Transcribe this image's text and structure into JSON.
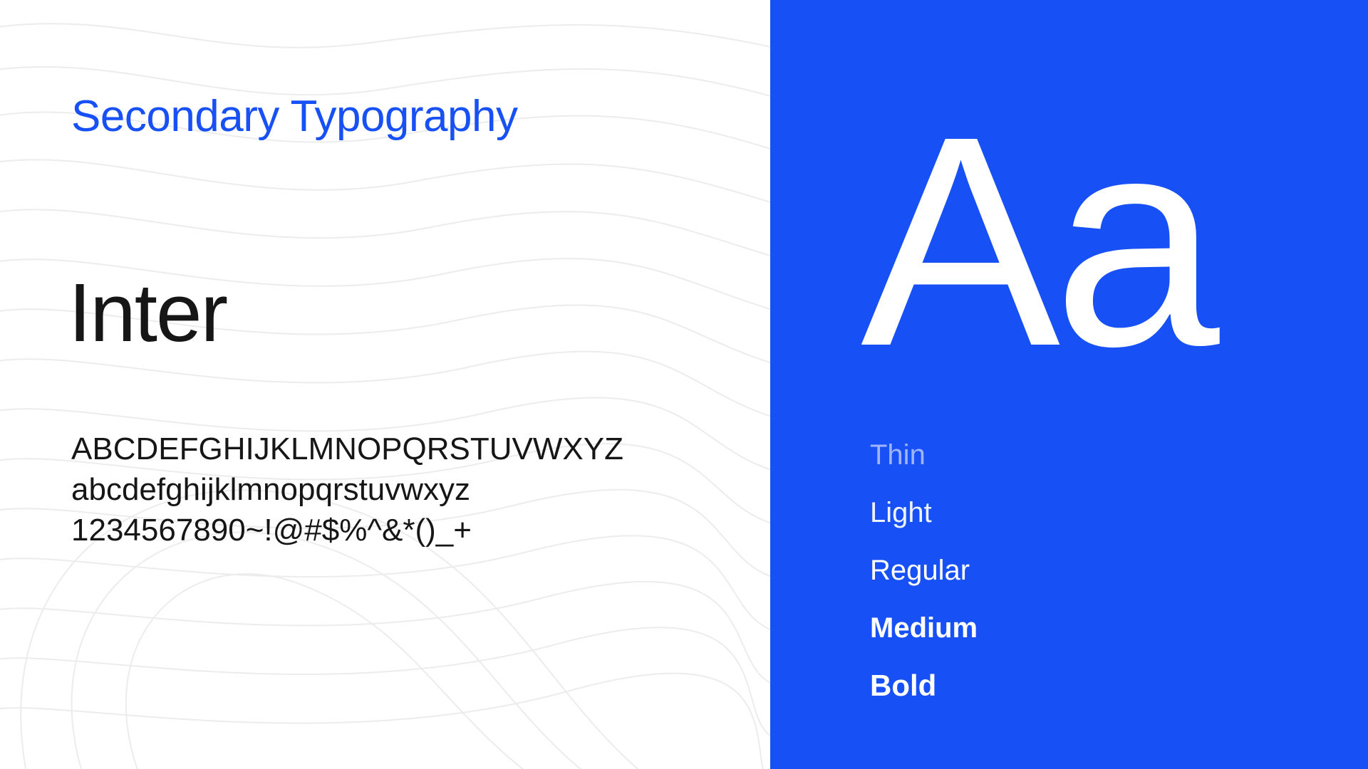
{
  "slide": {
    "title": "Secondary Typography",
    "font_name": "Inter",
    "charset": {
      "uppercase": "ABCDEFGHIJKLMNOPQRSTUVWXYZ",
      "lowercase": "abcdefghijklmnopqrstuvwxyz",
      "numbers_symbols": "1234567890~!@#$%^&*()_+"
    },
    "specimen": "Aa",
    "weights": [
      {
        "label": "Thin"
      },
      {
        "label": "Light"
      },
      {
        "label": "Regular"
      },
      {
        "label": "Medium"
      },
      {
        "label": "Bold"
      }
    ]
  },
  "colors": {
    "accent_blue": "#1751F5",
    "text_dark": "#161616",
    "background": "#FFFFFF",
    "contour_lines": "#ECECEC"
  }
}
